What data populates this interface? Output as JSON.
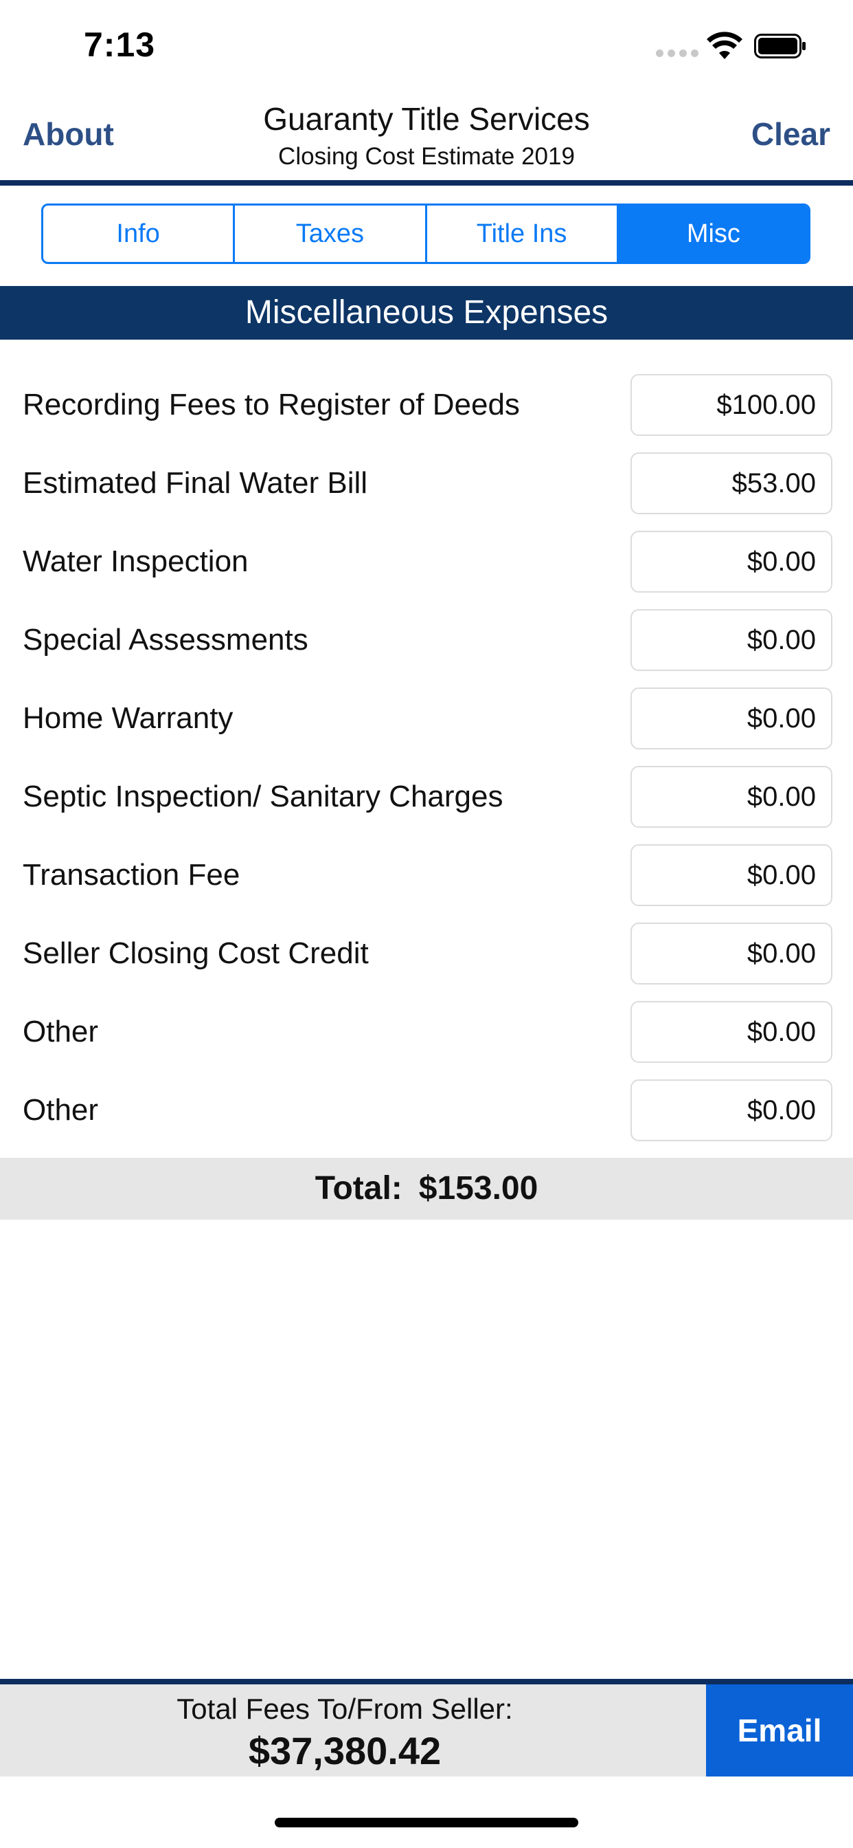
{
  "status_bar": {
    "time": "7:13",
    "icons": [
      "signal-dots-icon",
      "wifi-icon",
      "battery-icon"
    ]
  },
  "nav": {
    "left_button": "About",
    "right_button": "Clear",
    "title": "Guaranty Title Services",
    "subtitle": "Closing Cost Estimate 2019"
  },
  "tabs": [
    {
      "label": "Info",
      "active": false
    },
    {
      "label": "Taxes",
      "active": false
    },
    {
      "label": "Title Ins",
      "active": false
    },
    {
      "label": "Misc",
      "active": true
    }
  ],
  "section": {
    "title": "Miscellaneous Expenses"
  },
  "expenses": [
    {
      "label": "Recording Fees to Register of Deeds",
      "value": "$100.00"
    },
    {
      "label": "Estimated Final Water Bill",
      "value": "$53.00"
    },
    {
      "label": "Water Inspection",
      "value": "$0.00"
    },
    {
      "label": "Special Assessments",
      "value": "$0.00"
    },
    {
      "label": "Home Warranty",
      "value": "$0.00"
    },
    {
      "label": "Septic Inspection/ Sanitary Charges",
      "value": "$0.00"
    },
    {
      "label": "Transaction Fee",
      "value": "$0.00"
    },
    {
      "label": "Seller Closing Cost Credit",
      "value": "$0.00"
    },
    {
      "label": "Other",
      "value": "$0.00"
    },
    {
      "label": "Other",
      "value": "$0.00"
    }
  ],
  "total": {
    "label": "Total:",
    "value": "$153.00"
  },
  "footer": {
    "seller_label": "Total Fees To/From Seller:",
    "seller_total": "$37,380.42",
    "email_label": "Email"
  },
  "colors": {
    "accent": "#0a7af5",
    "navy": "#0d3566",
    "nav_text": "#2d4f86",
    "email_button": "#0a62d6",
    "total_bar": "#e6e6e6"
  }
}
